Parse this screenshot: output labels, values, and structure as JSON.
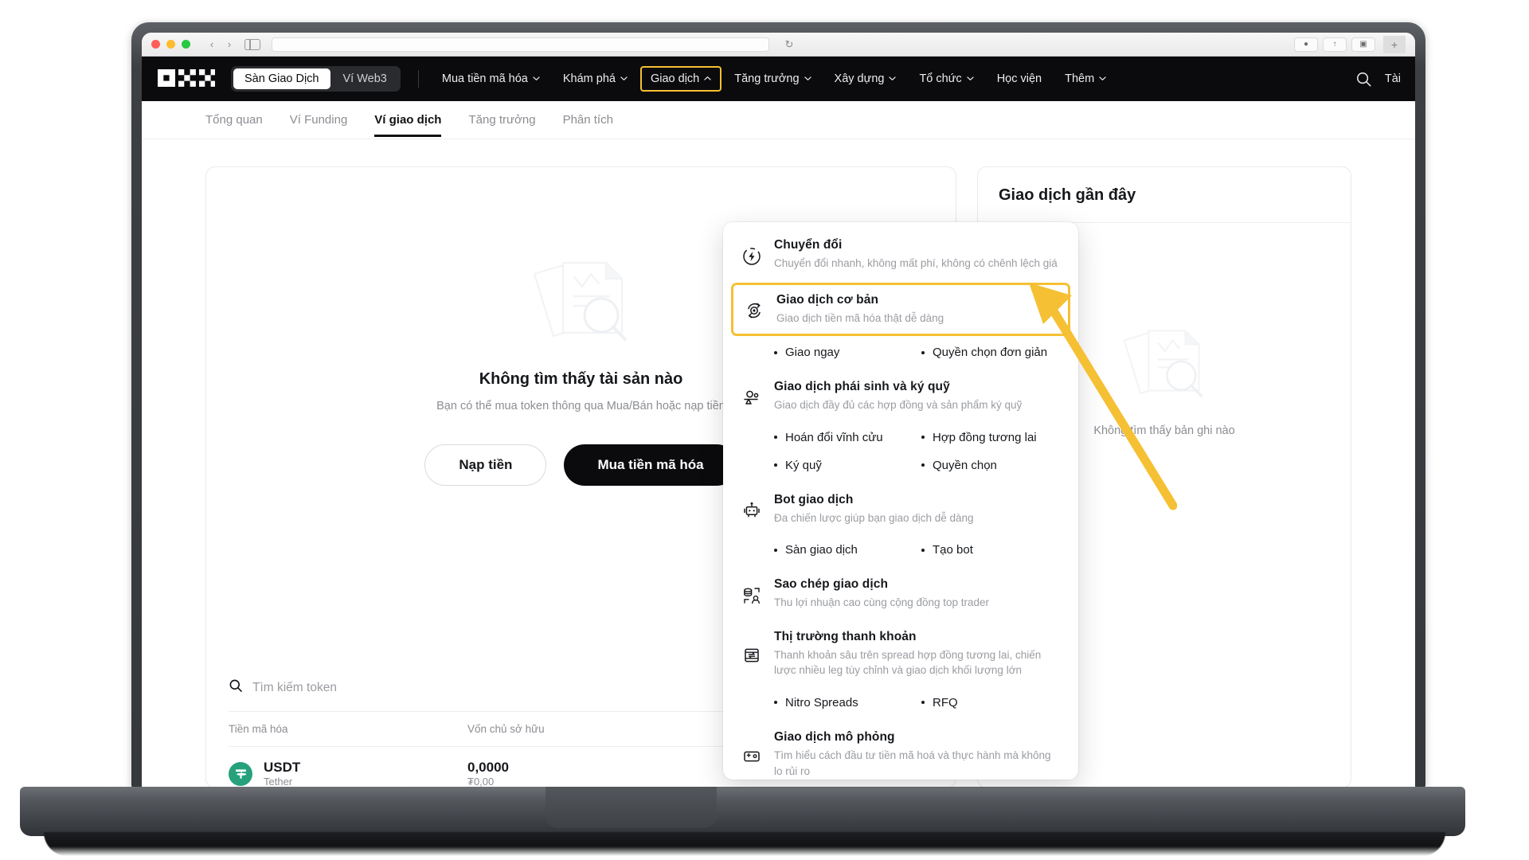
{
  "browser": {
    "url_placeholder": "",
    "back_icon": "chevron-left-icon",
    "forward_icon": "chevron-right-icon",
    "reload_icon": "reload-icon"
  },
  "header": {
    "logo": "okx-logo",
    "segmented": [
      {
        "label": "Sàn Giao Dịch",
        "active": true
      },
      {
        "label": "Ví Web3",
        "active": false
      }
    ],
    "nav": [
      {
        "label": "Mua tiền mã hóa",
        "caret": true,
        "highlight": false
      },
      {
        "label": "Khám phá",
        "caret": true,
        "highlight": false
      },
      {
        "label": "Giao dịch",
        "caret": true,
        "caret_up": true,
        "highlight": true
      },
      {
        "label": "Tăng trưởng",
        "caret": true,
        "highlight": false
      },
      {
        "label": "Xây dựng",
        "caret": true,
        "highlight": false
      },
      {
        "label": "Tổ chức",
        "caret": true,
        "highlight": false
      },
      {
        "label": "Học viện",
        "caret": false,
        "highlight": false
      },
      {
        "label": "Thêm",
        "caret": true,
        "highlight": false
      }
    ],
    "search_icon": "search-icon",
    "account_label": "Tài",
    "accent_color": "#F5C033",
    "bg_color": "#0b0b0d"
  },
  "subnav": {
    "items": [
      {
        "label": "Tổng quan",
        "active": false
      },
      {
        "label": "Ví Funding",
        "active": false
      },
      {
        "label": "Ví giao dịch",
        "active": true
      },
      {
        "label": "Tăng trưởng",
        "active": false
      },
      {
        "label": "Phân tích",
        "active": false
      }
    ]
  },
  "main": {
    "empty_state": {
      "illustration": "documents-search-illustration",
      "title": "Không tìm thấy tài sản nào",
      "subtitle": "Bạn có thể mua token thông qua Mua/Bán hoặc nạp tiền",
      "buttons": [
        {
          "label": "Nạp tiền",
          "style": "outline"
        },
        {
          "label": "Mua tiền mã hóa",
          "style": "dark"
        }
      ]
    },
    "token_search": {
      "icon": "search-icon",
      "placeholder": "Tìm kiếm token"
    },
    "token_table": {
      "columns": [
        "Tiền mã hóa",
        "Vốn chủ sở hữu"
      ],
      "rows": [
        {
          "symbol": "USDT",
          "name": "Tether",
          "icon": "tether-icon",
          "icon_color": "#26A17B",
          "equity": "0,0000",
          "equity_fiat": "₮0,00"
        }
      ]
    }
  },
  "right_panel": {
    "title": "Giao dịch gần đây",
    "empty_illustration": "documents-search-illustration",
    "empty_text": "Không tìm thấy bản ghi nào"
  },
  "dropdown": {
    "sections": [
      {
        "icon": "convert-icon",
        "title": "Chuyển đổi",
        "desc": "Chuyển đổi nhanh, không mất phí, không có chênh lệch giá",
        "boxed": false,
        "sublinks": []
      },
      {
        "icon": "basic-trade-icon",
        "title": "Giao dịch cơ bản",
        "desc": "Giao dịch tiền mã hóa thật dễ dàng",
        "boxed": true,
        "sublinks": [
          "Giao ngay",
          "Quyền chọn đơn giản"
        ]
      },
      {
        "icon": "derivatives-icon",
        "title": "Giao dịch phái sinh và ký quỹ",
        "desc": "Giao dịch đầy đủ các hợp đồng và sản phẩm ký quỹ",
        "boxed": false,
        "sublinks": [
          "Hoán đổi vĩnh cửu",
          "Hợp đồng tương lai",
          "Ký quỹ",
          "Quyền chọn"
        ]
      },
      {
        "icon": "bot-icon",
        "title": "Bot giao dịch",
        "desc": "Đa chiến lược giúp bạn giao dịch dễ dàng",
        "boxed": false,
        "sublinks": [
          "Sàn giao dịch",
          "Tạo bot"
        ]
      },
      {
        "icon": "copy-trading-icon",
        "title": "Sao chép giao dịch",
        "desc": "Thu lợi nhuận cao cùng cộng đồng top trader",
        "boxed": false,
        "sublinks": []
      },
      {
        "icon": "liquidity-icon",
        "title": "Thị trường thanh khoản",
        "desc": "Thanh khoản sâu trên spread hợp đồng tương lai, chiến lược nhiều leg tùy chỉnh và giao dịch khối lượng lớn",
        "boxed": false,
        "sublinks": [
          "Nitro Spreads",
          "RFQ"
        ]
      },
      {
        "icon": "demo-trading-icon",
        "title": "Giao dịch mô phỏng",
        "desc": "Tìm hiểu cách đầu tư tiền mã hoá và thực hành mà không lo rủi ro",
        "boxed": false,
        "sublinks": []
      }
    ]
  },
  "annotation": {
    "arrow_color": "#F5C033",
    "highlight_color": "#F5C033"
  }
}
